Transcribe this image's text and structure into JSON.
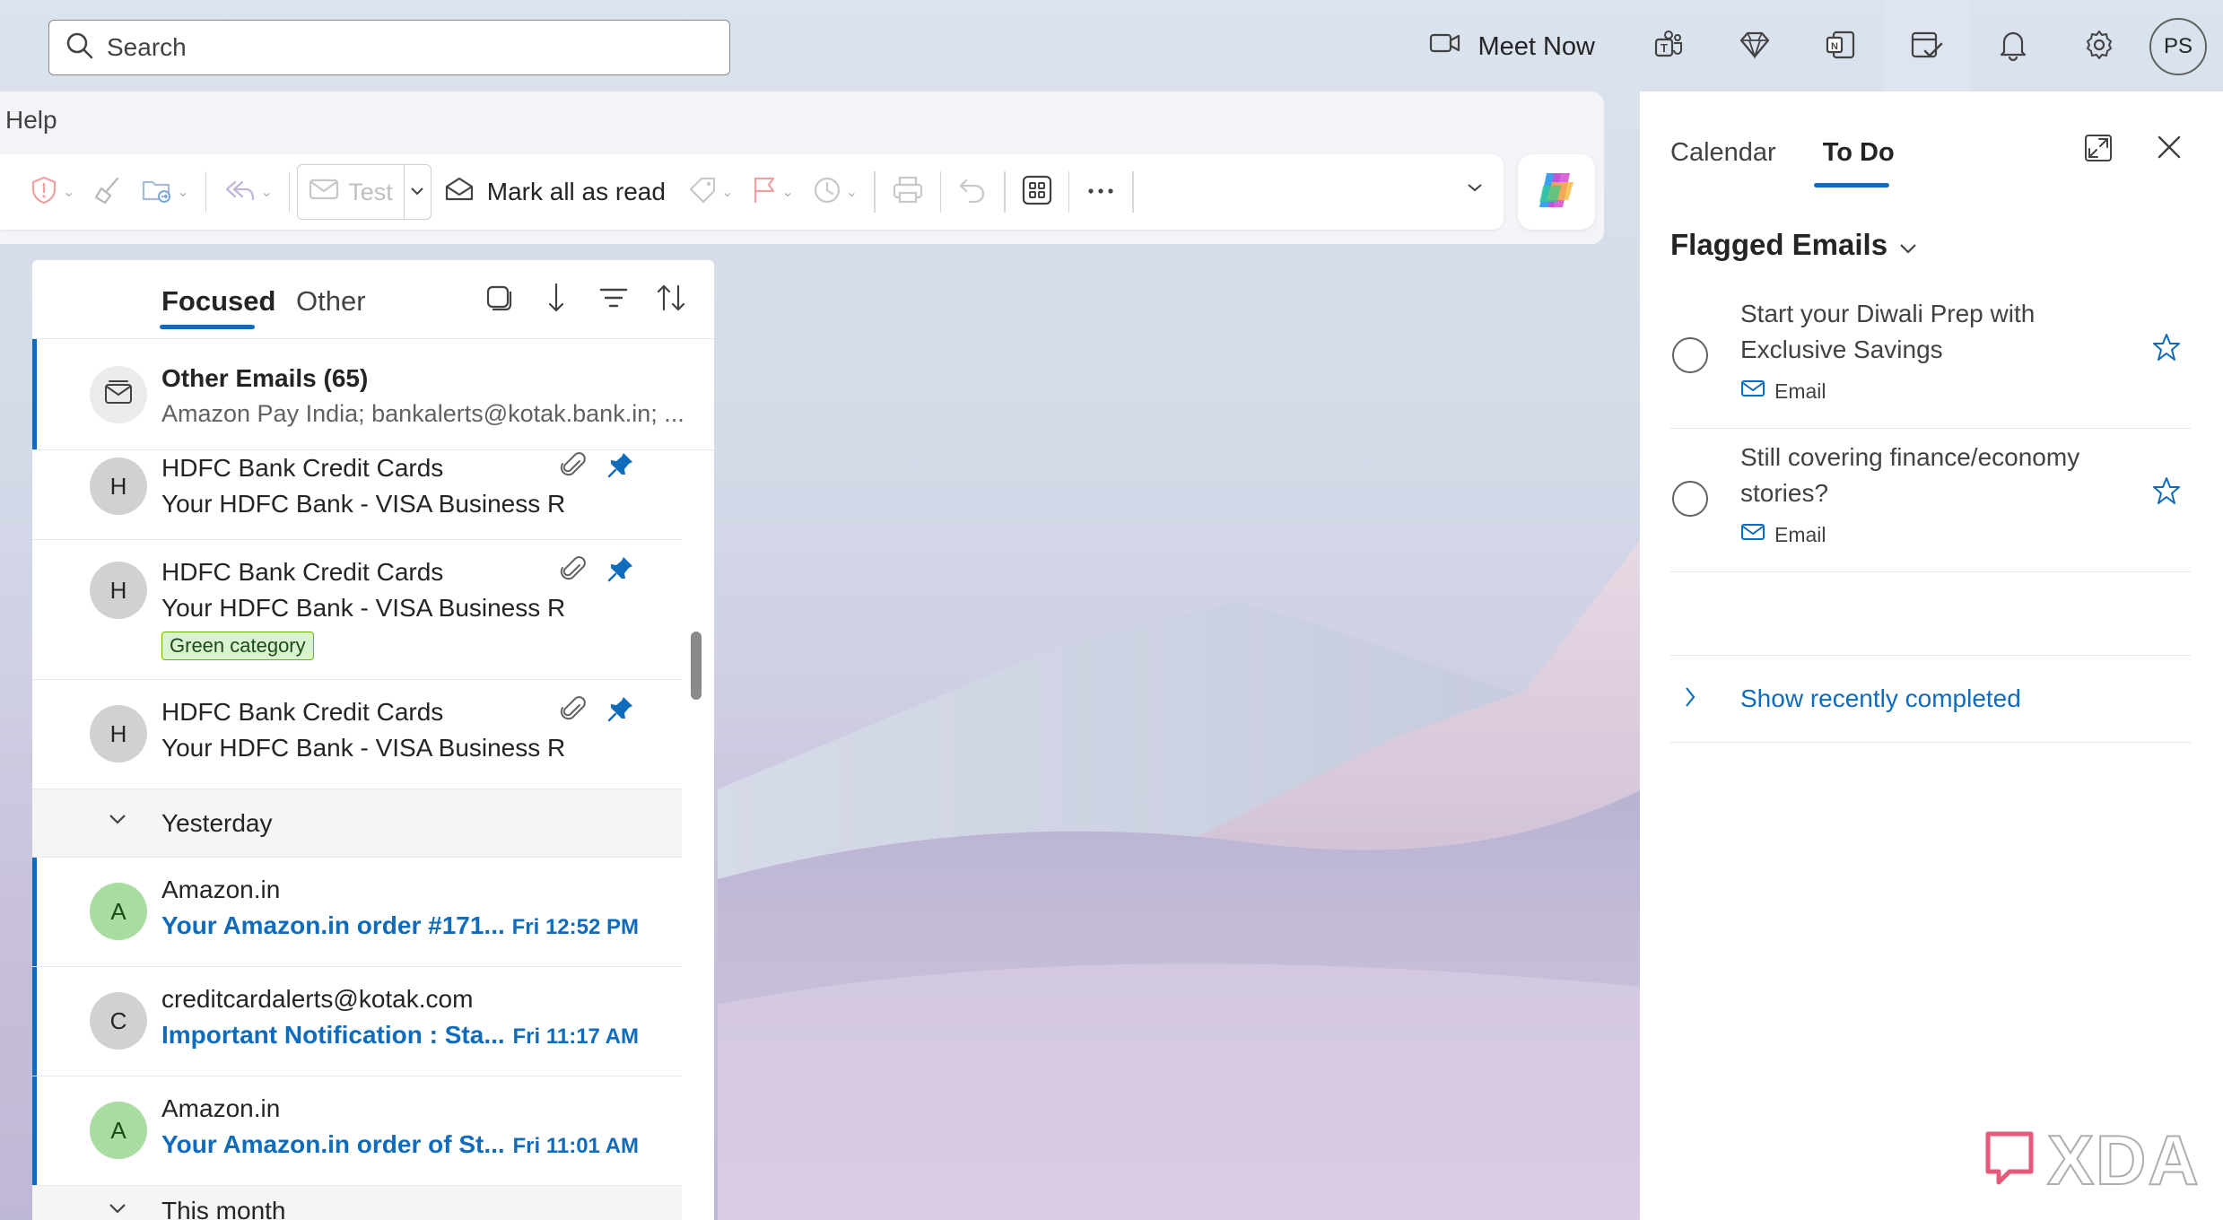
{
  "search": {
    "placeholder": "Search"
  },
  "topbar": {
    "meet_now_label": "Meet Now",
    "avatar_initials": "PS",
    "icons": [
      "video-icon",
      "teams-icon",
      "premium-diamond-icon",
      "onenote-icon",
      "todo-icon",
      "bell-icon",
      "gear-icon"
    ]
  },
  "ribbon": {
    "menu_help": "Help",
    "test_label": "Test",
    "mark_all_read_label": "Mark all as read"
  },
  "maillist": {
    "tabs": {
      "focused": "Focused",
      "other": "Other"
    },
    "other_emails": {
      "title": "Other Emails (65)",
      "preview": "Amazon Pay India; bankalerts@kotak.bank.in; ..."
    },
    "items": [
      {
        "initial": "H",
        "sender": "HDFC Bank Credit Cards",
        "subject": "Your HDFC Bank - VISA Business R"
      },
      {
        "initial": "H",
        "sender": "HDFC Bank Credit Cards",
        "subject": "Your HDFC Bank - VISA Business R",
        "category": "Green category"
      },
      {
        "initial": "H",
        "sender": "HDFC Bank Credit Cards",
        "subject": "Your HDFC Bank - VISA Business R"
      }
    ],
    "group_yesterday": "Yesterday",
    "yesterday_items": [
      {
        "initial": "A",
        "sender": "Amazon.in",
        "subject": "Your Amazon.in order #171...",
        "time": "Fri 12:52 PM"
      },
      {
        "initial": "C",
        "sender": "creditcardalerts@kotak.com",
        "subject": "Important Notification : Sta...",
        "time": "Fri 11:17 AM"
      },
      {
        "initial": "A",
        "sender": "Amazon.in",
        "subject": "Your Amazon.in order of St...",
        "time": "Fri 11:01 AM"
      }
    ],
    "group_this_month": "This month"
  },
  "todo": {
    "tabs": {
      "calendar": "Calendar",
      "todo": "To Do"
    },
    "section_title": "Flagged Emails",
    "tasks": [
      {
        "title": "Start your Diwali Prep with Exclusive Savings",
        "kind": "Email"
      },
      {
        "title": "Still covering finance/economy stories?",
        "kind": "Email"
      }
    ],
    "show_recent_label": "Show recently completed"
  },
  "watermark": {
    "text": "XDA"
  },
  "colors": {
    "accent": "#0f6cbd",
    "avatar_green": "#a9dca0",
    "avatar_grey": "#d1d1d1",
    "category_green": "#6bb700"
  }
}
